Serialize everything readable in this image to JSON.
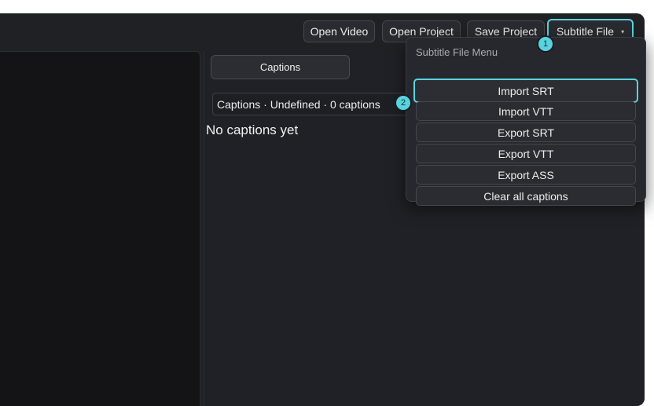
{
  "toolbar": {
    "open_video": "Open Video",
    "open_project": "Open Project",
    "save_project": "Save Project",
    "subtitle_file": "Subtitle File",
    "caret": "▾"
  },
  "captions_panel": {
    "tab_label": "Captions",
    "selector_label": "Captions · Undefined · 0 captions",
    "empty_message": "No captions yet"
  },
  "subtitle_menu": {
    "title": "Subtitle File Menu",
    "items": [
      {
        "label": "Import SRT"
      },
      {
        "label": "Import VTT"
      },
      {
        "label": "Export SRT"
      },
      {
        "label": "Export VTT"
      },
      {
        "label": "Export ASS"
      },
      {
        "label": "Clear all captions"
      }
    ]
  },
  "markers": [
    "1",
    "2"
  ],
  "colors": {
    "accent": "#58d3df",
    "window_bg": "#202125",
    "button_bg": "#2a2b30"
  }
}
